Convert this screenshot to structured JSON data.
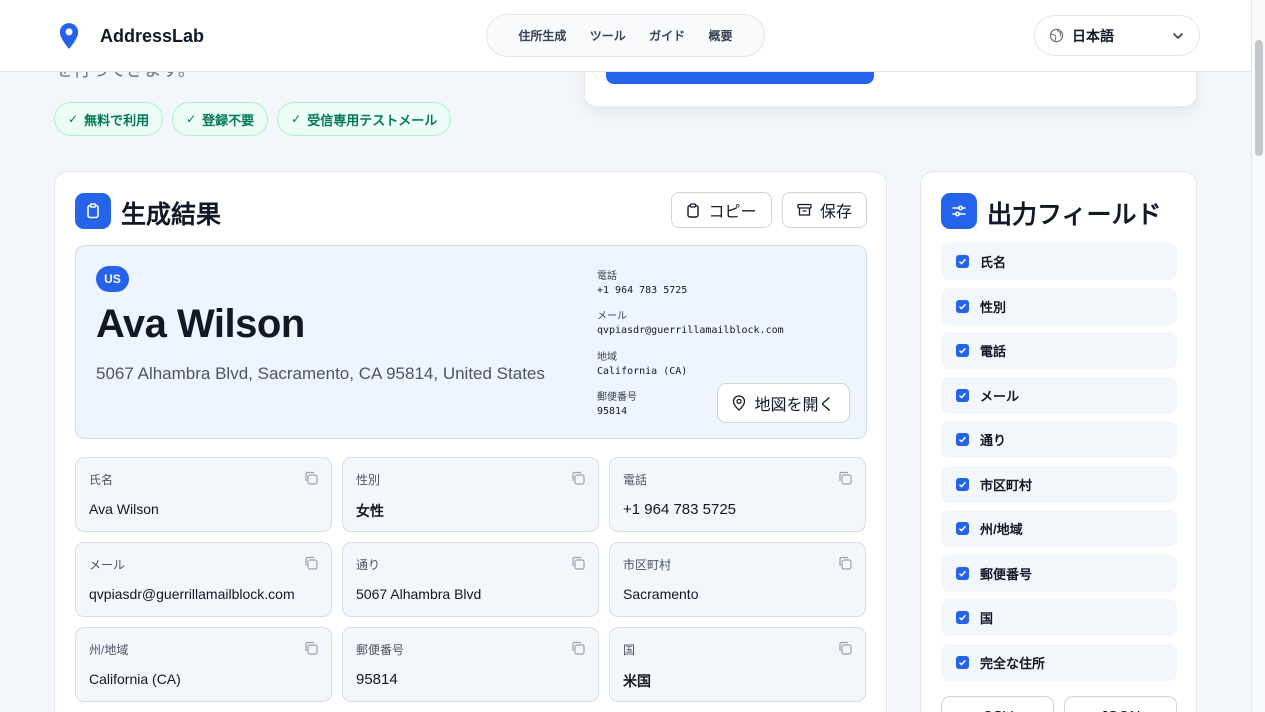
{
  "nav": {
    "brand": "AddressLab",
    "links": [
      "住所生成",
      "ツール",
      "ガイド",
      "概要"
    ],
    "language": "日本語"
  },
  "hero": {
    "partial_text": "を行ってきます。",
    "badges": [
      "無料で利用",
      "登録不要",
      "受信専用テストメール"
    ]
  },
  "result": {
    "title": "生成結果",
    "copy_label": "コピー",
    "save_label": "保存",
    "summary": {
      "country_code": "US",
      "name": "Ava Wilson",
      "address": "5067 Alhambra Blvd, Sacramento, CA 95814, United States",
      "phone_label": "電話",
      "phone": "+1 964 783 5725",
      "email_label": "メール",
      "email": "qvpiasdr@guerrillamailblock.com",
      "region_label": "地域",
      "region": "California (CA)",
      "zip_label": "郵便番号",
      "zip": "95814",
      "map_label": "地図を開く"
    },
    "fields": [
      {
        "label": "氏名",
        "value": "Ava Wilson"
      },
      {
        "label": "性別",
        "value": "女性"
      },
      {
        "label": "電話",
        "value": "+1 964 783 5725"
      },
      {
        "label": "メール",
        "value": "qvpiasdr@guerrillamailblock.com"
      },
      {
        "label": "通り",
        "value": "5067 Alhambra Blvd"
      },
      {
        "label": "市区町村",
        "value": "Sacramento"
      },
      {
        "label": "州/地域",
        "value": "California (CA)"
      },
      {
        "label": "郵便番号",
        "value": "95814"
      },
      {
        "label": "国",
        "value": "米国"
      }
    ]
  },
  "output_fields": {
    "title": "出力フィールド",
    "items": [
      "氏名",
      "性別",
      "電話",
      "メール",
      "通り",
      "市区町村",
      "州/地域",
      "郵便番号",
      "国",
      "完全な住所"
    ],
    "export_buttons": [
      "CSV",
      "JSON"
    ]
  },
  "colors": {
    "accent": "#2563eb",
    "badge_text": "#047857",
    "badge_bg": "#ecfdf5"
  }
}
